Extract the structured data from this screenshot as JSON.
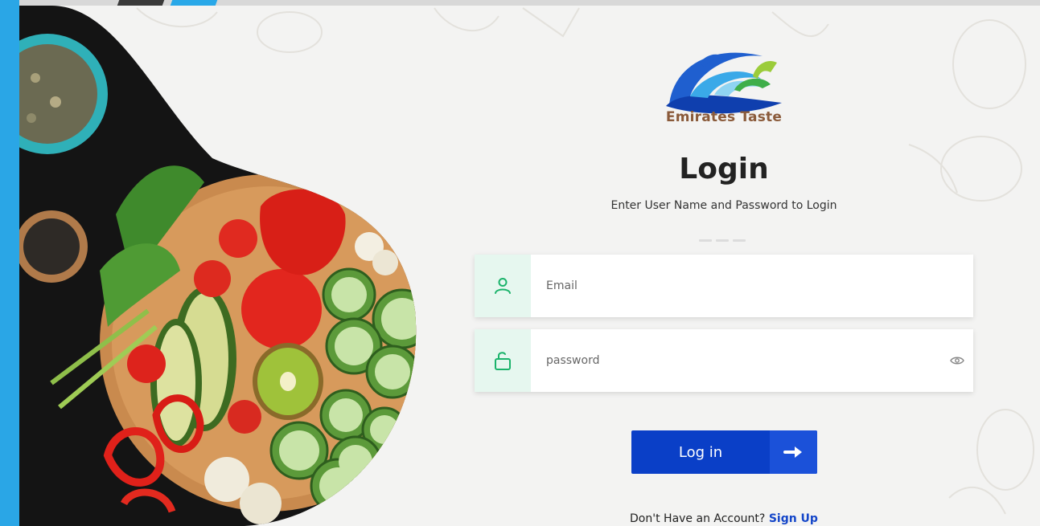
{
  "brand": {
    "name": "Emirates Taste"
  },
  "login": {
    "title": "Login",
    "subtitle": "Enter User Name and Password to Login",
    "email_placeholder": "Email",
    "password_placeholder": "password",
    "button_label": "Log in"
  },
  "signup": {
    "prompt": "Don't Have an Account?",
    "link_label": "Sign Up"
  },
  "icons": {
    "email": "user-icon",
    "password": "unlock-icon",
    "toggle": "eye-icon",
    "submit": "arrow-right-icon"
  },
  "colors": {
    "accent": "#0a3fc7",
    "rail": "#2aa6e6",
    "icon_green": "#1bb36b",
    "icon_bg": "#e6f7ef",
    "link": "#1446c9",
    "brand_text": "#8a5a3a"
  }
}
